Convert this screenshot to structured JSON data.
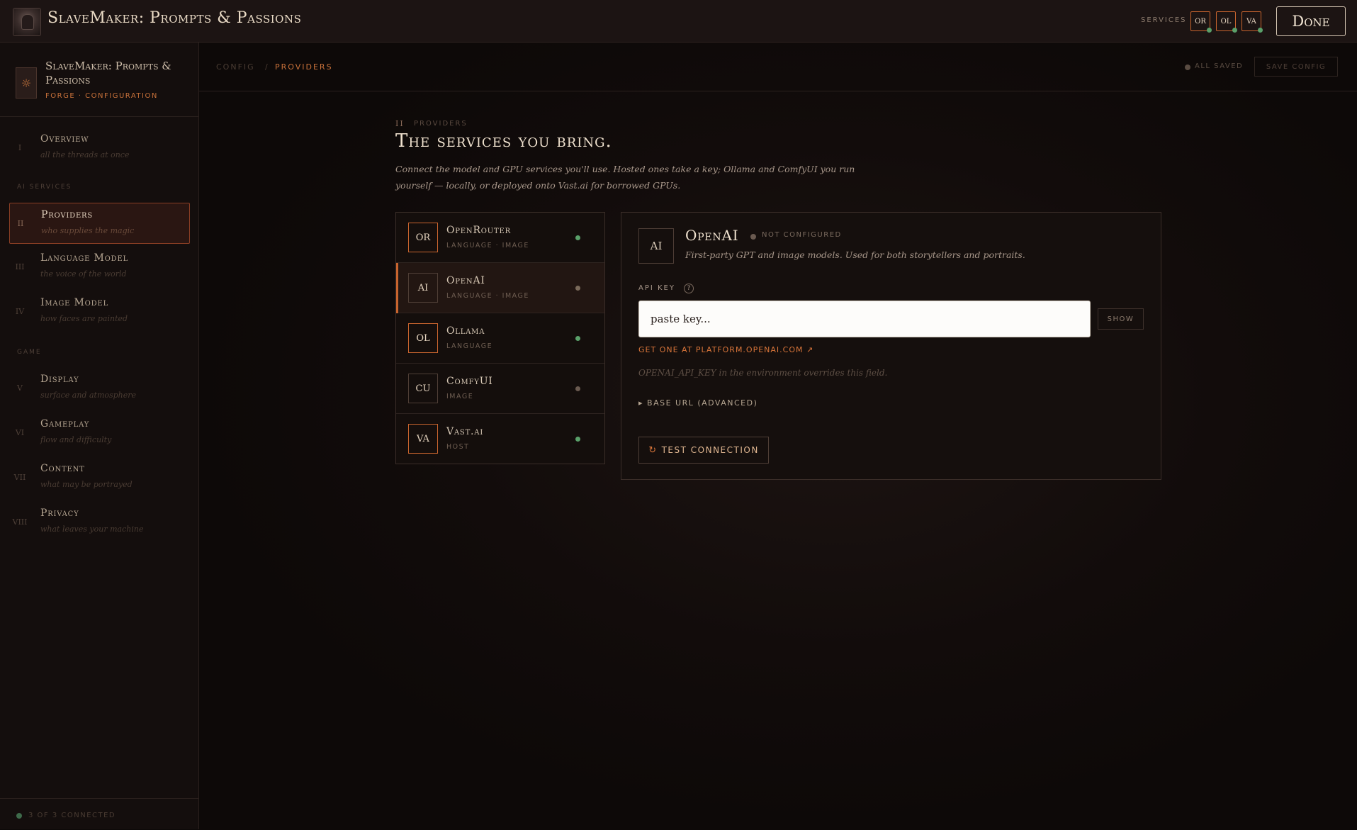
{
  "header": {
    "app_title": "SlaveMaker: Prompts & Passions",
    "services_label": "SERVICES",
    "service_badges": [
      {
        "code": "OR",
        "status": "connected"
      },
      {
        "code": "OL",
        "status": "connected"
      },
      {
        "code": "VA",
        "status": "connected"
      }
    ],
    "done_label": "Done"
  },
  "sidebar": {
    "name": "SlaveMaker: Prompts & Passions",
    "subtitle": "FORGE · CONFIGURATION",
    "sections": {
      "ai_services": "AI SERVICES",
      "game": "GAME"
    },
    "items": [
      {
        "num": "I",
        "label": "Overview",
        "hint": "all the threads at once"
      },
      {
        "num": "II",
        "label": "Providers",
        "hint": "who supplies the magic",
        "active": true
      },
      {
        "num": "III",
        "label": "Language Model",
        "hint": "the voice of the world"
      },
      {
        "num": "IV",
        "label": "Image Model",
        "hint": "how faces are painted"
      },
      {
        "num": "V",
        "label": "Display",
        "hint": "surface and atmosphere"
      },
      {
        "num": "VI",
        "label": "Gameplay",
        "hint": "flow and difficulty"
      },
      {
        "num": "VII",
        "label": "Content",
        "hint": "what may be portrayed"
      },
      {
        "num": "VIII",
        "label": "Privacy",
        "hint": "what leaves your machine"
      }
    ],
    "footer": "3 OF 3 CONNECTED"
  },
  "breadcrumb": {
    "root": "CONFIG",
    "separator": "/",
    "current": "PROVIDERS"
  },
  "save_status": "ALL SAVED",
  "save_button": "SAVE CONFIG",
  "section": {
    "num": "II",
    "tag": "PROVIDERS",
    "heading": "The services you bring.",
    "intro": "Connect the model and GPU services you'll use. Hosted ones take a key; Ollama and ComfyUI you run yourself — locally, or deployed onto Vast.ai for borrowed GPUs."
  },
  "providers": [
    {
      "code": "OR",
      "name": "OpenRouter",
      "caps": "LANGUAGE · IMAGE",
      "status": "connected"
    },
    {
      "code": "AI",
      "name": "OpenAI",
      "caps": "LANGUAGE · IMAGE",
      "status": "not_configured",
      "active": true
    },
    {
      "code": "OL",
      "name": "Ollama",
      "caps": "LANGUAGE",
      "status": "connected"
    },
    {
      "code": "CU",
      "name": "ComfyUI",
      "caps": "IMAGE",
      "status": "not_configured"
    },
    {
      "code": "VA",
      "name": "Vast.ai",
      "caps": "HOST",
      "status": "connected"
    }
  ],
  "detail": {
    "code": "AI",
    "name": "OpenAI",
    "status": "NOT CONFIGURED",
    "description": "First-party GPT and image models. Used for both storytellers and portraits.",
    "api_key_label": "API KEY",
    "help_glyph": "?",
    "api_key_placeholder": "paste key...",
    "show_label": "SHOW",
    "get_key_link": "GET ONE AT PLATFORM.OPENAI.COM ↗",
    "env_note": "OPENAI_API_KEY in the environment overrides this field.",
    "advanced_label": "▸ BASE URL (ADVANCED)",
    "test_label": "TEST CONNECTION",
    "test_icon": "↻"
  },
  "colors": {
    "accent": "#c8642e",
    "connected": "#5aa06a",
    "not_configured": "#6a5a50",
    "link": "#d9753a"
  }
}
